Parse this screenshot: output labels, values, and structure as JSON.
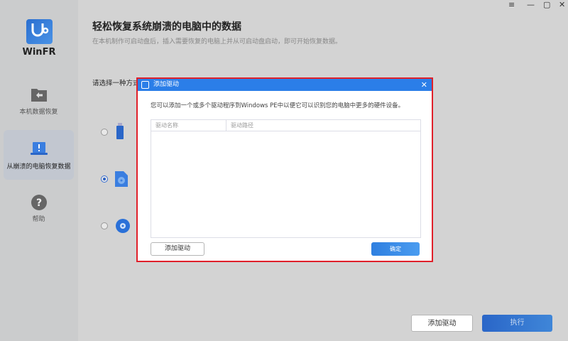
{
  "app": {
    "name": "WinFR"
  },
  "window_controls": [
    "menu-icon",
    "minimize-icon",
    "maximize-icon",
    "close-icon"
  ],
  "sidebar": {
    "items": [
      {
        "label": "本机数据恢复",
        "icon": "folder-back-icon"
      },
      {
        "label": "从崩溃的电脑恢复数据",
        "icon": "laptop-alert-icon",
        "selected": true
      },
      {
        "label": "帮助",
        "icon": "help-icon"
      }
    ]
  },
  "main": {
    "title": "轻松恢复系统崩溃的电脑中的数据",
    "subtitle": "在本机制作可启动盘后，插入需要恢复的电脑上并从可启动盘启动，即可开始恢复数据。",
    "choose_label": "请选择一种方式",
    "options": [
      {
        "icon": "usb-drive-icon",
        "selected": false
      },
      {
        "icon": "iso-file-icon",
        "selected": true
      },
      {
        "icon": "cd-disc-icon",
        "selected": false
      }
    ],
    "add_driver_label": "添加驱动",
    "execute_label": "执行"
  },
  "dialog": {
    "title": "添加驱动",
    "description": "您可以添加一个或多个驱动程序到Windows PE中以便它可以识别您的电脑中更多的硬件设备。",
    "columns": [
      "驱动名称",
      "驱动路径"
    ],
    "rows": [],
    "add_label": "添加驱动",
    "ok_label": "确定"
  },
  "colors": {
    "accent": "#2b7ee8",
    "highlight_border": "#e0202a"
  }
}
